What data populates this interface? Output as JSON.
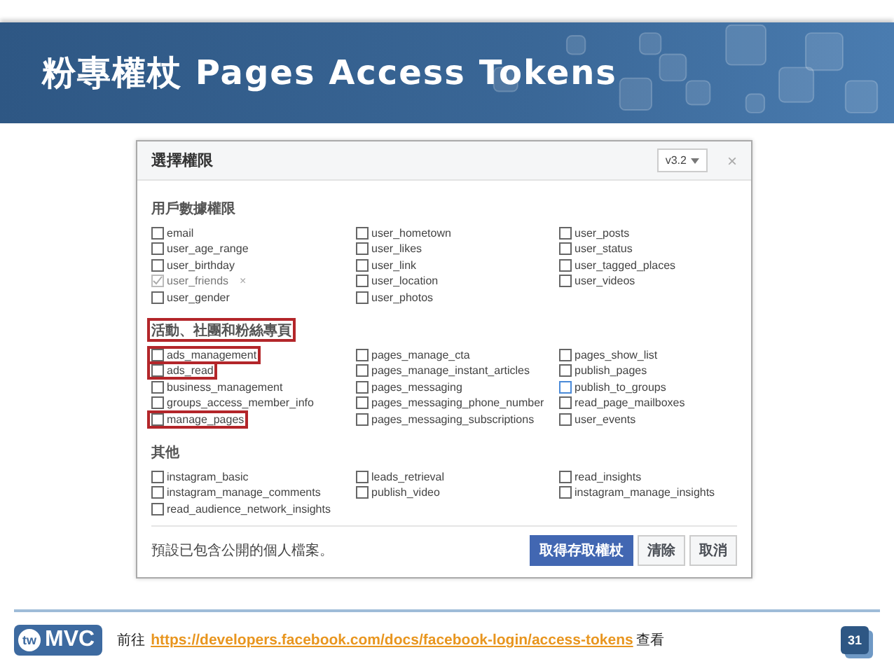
{
  "slide_title": "粉專權杖 Pages Access Tokens",
  "dialog": {
    "title": "選擇權限",
    "version": "v3.2",
    "close": "×",
    "sections": [
      {
        "heading": "用戶數據權限",
        "highlighted": false,
        "columns": [
          [
            {
              "label": "email",
              "checked": false,
              "focused": false,
              "highlighted": false
            },
            {
              "label": "user_age_range",
              "checked": false,
              "focused": false,
              "highlighted": false
            },
            {
              "label": "user_birthday",
              "checked": false,
              "focused": false,
              "highlighted": false
            },
            {
              "label": "user_friends",
              "checked": true,
              "focused": false,
              "highlighted": false,
              "remove": "×"
            },
            {
              "label": "user_gender",
              "checked": false,
              "focused": false,
              "highlighted": false
            }
          ],
          [
            {
              "label": "user_hometown",
              "checked": false,
              "focused": false,
              "highlighted": false
            },
            {
              "label": "user_likes",
              "checked": false,
              "focused": false,
              "highlighted": false
            },
            {
              "label": "user_link",
              "checked": false,
              "focused": false,
              "highlighted": false
            },
            {
              "label": "user_location",
              "checked": false,
              "focused": false,
              "highlighted": false
            },
            {
              "label": "user_photos",
              "checked": false,
              "focused": false,
              "highlighted": false
            }
          ],
          [
            {
              "label": "user_posts",
              "checked": false,
              "focused": false,
              "highlighted": false
            },
            {
              "label": "user_status",
              "checked": false,
              "focused": false,
              "highlighted": false
            },
            {
              "label": "user_tagged_places",
              "checked": false,
              "focused": false,
              "highlighted": false
            },
            {
              "label": "user_videos",
              "checked": false,
              "focused": false,
              "highlighted": false
            }
          ]
        ]
      },
      {
        "heading": "活動、社團和粉絲專頁",
        "highlighted": true,
        "columns": [
          [
            {
              "label": "ads_management",
              "checked": false,
              "focused": false,
              "highlighted": true
            },
            {
              "label": "ads_read",
              "checked": false,
              "focused": false,
              "highlighted": true
            },
            {
              "label": "business_management",
              "checked": false,
              "focused": false,
              "highlighted": false
            },
            {
              "label": "groups_access_member_info",
              "checked": false,
              "focused": false,
              "highlighted": false
            },
            {
              "label": "manage_pages",
              "checked": false,
              "focused": false,
              "highlighted": true
            }
          ],
          [
            {
              "label": "pages_manage_cta",
              "checked": false,
              "focused": false,
              "highlighted": false
            },
            {
              "label": "pages_manage_instant_articles",
              "checked": false,
              "focused": false,
              "highlighted": false
            },
            {
              "label": "pages_messaging",
              "checked": false,
              "focused": false,
              "highlighted": false
            },
            {
              "label": "pages_messaging_phone_number",
              "checked": false,
              "focused": false,
              "highlighted": false
            },
            {
              "label": "pages_messaging_subscriptions",
              "checked": false,
              "focused": false,
              "highlighted": false
            }
          ],
          [
            {
              "label": "pages_show_list",
              "checked": false,
              "focused": false,
              "highlighted": false
            },
            {
              "label": "publish_pages",
              "checked": false,
              "focused": false,
              "highlighted": false
            },
            {
              "label": "publish_to_groups",
              "checked": false,
              "focused": true,
              "highlighted": false
            },
            {
              "label": "read_page_mailboxes",
              "checked": false,
              "focused": false,
              "highlighted": false
            },
            {
              "label": "user_events",
              "checked": false,
              "focused": false,
              "highlighted": false
            }
          ]
        ]
      },
      {
        "heading": "其他",
        "highlighted": false,
        "columns": [
          [
            {
              "label": "instagram_basic",
              "checked": false,
              "focused": false,
              "highlighted": false
            },
            {
              "label": "instagram_manage_comments",
              "checked": false,
              "focused": false,
              "highlighted": false
            },
            {
              "label": "read_audience_network_insights",
              "checked": false,
              "focused": false,
              "highlighted": false
            }
          ],
          [
            {
              "label": "leads_retrieval",
              "checked": false,
              "focused": false,
              "highlighted": false
            },
            {
              "label": "publish_video",
              "checked": false,
              "focused": false,
              "highlighted": false
            }
          ],
          [
            {
              "label": "read_insights",
              "checked": false,
              "focused": false,
              "highlighted": false
            },
            {
              "label": "instagram_manage_insights",
              "checked": false,
              "focused": false,
              "highlighted": false
            }
          ]
        ]
      }
    ],
    "note": "預設已包含公開的個人檔案。",
    "buttons": [
      {
        "label": "取得存取權杖",
        "kind": "primary"
      },
      {
        "label": "清除",
        "kind": "secondary"
      },
      {
        "label": "取消",
        "kind": "secondary"
      }
    ]
  },
  "footer": {
    "logo_prefix": "tw",
    "logo_text": "MVC",
    "lead": "前往",
    "link": "https://developers.facebook.com/docs/facebook-login/access-tokens",
    "trail": "查看",
    "page_number": "31"
  }
}
